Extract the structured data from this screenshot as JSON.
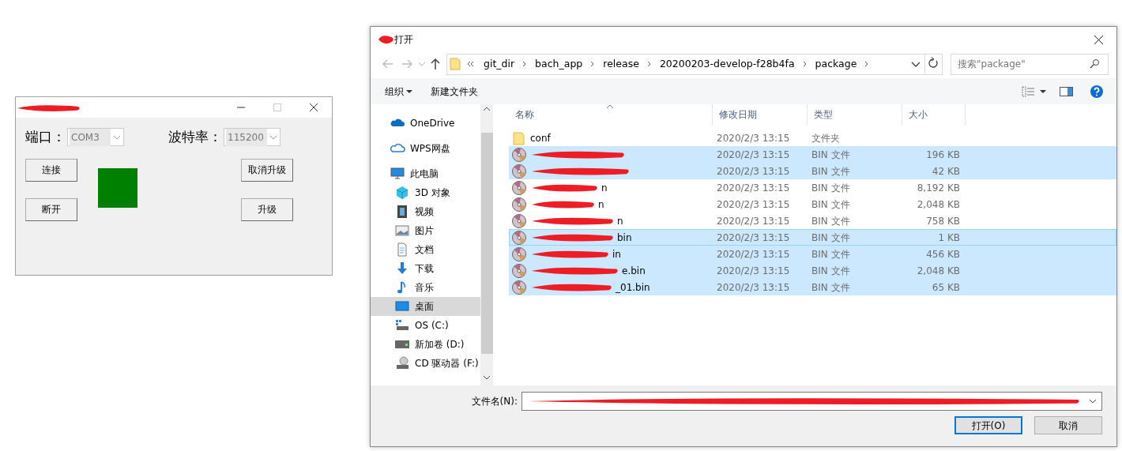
{
  "app_window": {
    "title": {
      "redacted": true
    },
    "fields": [
      {
        "label": "端口：",
        "value": "COM3"
      },
      {
        "label": "波特率：",
        "value": "115200"
      }
    ],
    "buttons": [
      "连接",
      "断开",
      "取消升级",
      "升级"
    ],
    "status_light": {
      "color": "#008000"
    }
  },
  "dialog": {
    "title": "打开",
    "icon": {
      "redacted": true
    },
    "breadcrumb": [
      "git_dir",
      "bach_app",
      "release",
      "20200203-develop-f28b4fa",
      "package"
    ],
    "search": {
      "placeholder": "搜索\"package\""
    },
    "toolbar": [
      "组织",
      "新建文件夹"
    ],
    "nav": [
      {
        "label": "OneDrive",
        "kind": "cloud",
        "selected": false
      },
      {
        "label": "WPS网盘",
        "kind": "wps",
        "selected": false
      },
      {
        "label": "此电脑",
        "kind": "pc",
        "selected": false,
        "children": [
          {
            "label": "3D 对象",
            "kind": "cube",
            "selected": false
          },
          {
            "label": "视频",
            "kind": "video",
            "selected": false
          },
          {
            "label": "图片",
            "kind": "picture",
            "selected": false
          },
          {
            "label": "文档",
            "kind": "document",
            "selected": false
          },
          {
            "label": "下载",
            "kind": "download",
            "selected": false
          },
          {
            "label": "音乐",
            "kind": "music",
            "selected": false
          },
          {
            "label": "桌面",
            "kind": "desktop",
            "selected": true
          },
          {
            "label": "OS (C:)",
            "kind": "system-drive",
            "selected": false
          },
          {
            "label": "新加卷 (D:)",
            "kind": "drive",
            "selected": false
          },
          {
            "label": "CD 驱动器 (F:)",
            "kind": "cd",
            "selected": false
          }
        ]
      }
    ],
    "columns": [
      "名称",
      "修改日期",
      "类型",
      "大小"
    ],
    "files": [
      {
        "kind": "folder",
        "name": "conf",
        "date": "2020/2/3 13:15",
        "type": "文件夹",
        "selected": false,
        "focused": false,
        "redacted": false
      },
      {
        "kind": "bin",
        "date": "2020/2/3 13:15",
        "type": "BIN 文件",
        "size": "196 KB",
        "selected": true,
        "focused": false,
        "redacted": true
      },
      {
        "kind": "bin",
        "date": "2020/2/3 13:15",
        "type": "BIN 文件",
        "size": "42 KB",
        "selected": true,
        "focused": false,
        "redacted": true
      },
      {
        "kind": "bin",
        "name": "n",
        "date": "2020/2/3 13:15",
        "type": "BIN 文件",
        "size": "8,192 KB",
        "selected": false,
        "focused": false,
        "redacted": true
      },
      {
        "kind": "bin",
        "name": "n",
        "date": "2020/2/3 13:15",
        "type": "BIN 文件",
        "size": "2,048 KB",
        "selected": false,
        "focused": false,
        "redacted": true
      },
      {
        "kind": "bin",
        "name": "n",
        "date": "2020/2/3 13:15",
        "type": "BIN 文件",
        "size": "758 KB",
        "selected": false,
        "focused": false,
        "redacted": true
      },
      {
        "kind": "bin",
        "name": "bin",
        "date": "2020/2/3 13:15",
        "type": "BIN 文件",
        "size": "1 KB",
        "selected": true,
        "focused": true,
        "redacted": true
      },
      {
        "kind": "bin",
        "name": "in",
        "date": "2020/2/3 13:15",
        "type": "BIN 文件",
        "size": "456 KB",
        "selected": true,
        "focused": false,
        "redacted": true
      },
      {
        "kind": "bin",
        "name": "e.bin",
        "date": "2020/2/3 13:15",
        "type": "BIN 文件",
        "size": "2,048 KB",
        "selected": true,
        "focused": false,
        "redacted": true
      },
      {
        "kind": "bin",
        "name": "_01.bin",
        "date": "2020/2/3 13:15",
        "type": "BIN 文件",
        "size": "65 KB",
        "selected": true,
        "focused": false,
        "redacted": true
      }
    ],
    "filename": {
      "label": "文件名(N):",
      "redacted": true
    },
    "buttons": [
      "打开(O)",
      "取消"
    ]
  }
}
